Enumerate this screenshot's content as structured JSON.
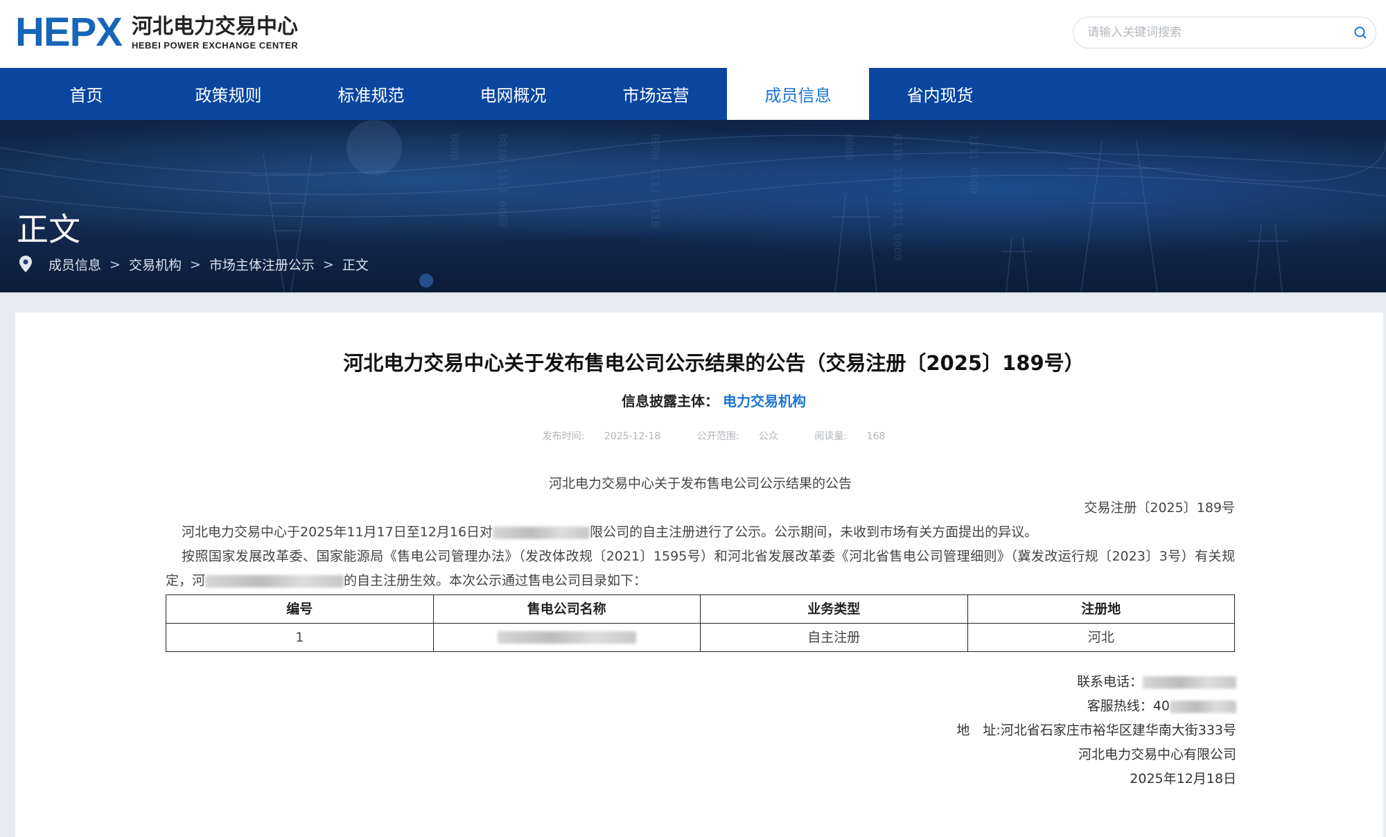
{
  "header": {
    "logo_mark": "HEPX",
    "logo_cn": "河北电力交易中心",
    "logo_en": "HEBEI POWER EXCHANGE CENTER",
    "search_placeholder": "请输入关键词搜索",
    "search_icon": "search-icon"
  },
  "nav": {
    "items": [
      {
        "label": "首页"
      },
      {
        "label": "政策规则"
      },
      {
        "label": "标准规范"
      },
      {
        "label": "电网概况"
      },
      {
        "label": "市场运营"
      },
      {
        "label": "成员信息",
        "active": true
      },
      {
        "label": "省内现货"
      }
    ],
    "active_color": "#1a74d2",
    "bar_color": "#0a46a0"
  },
  "banner": {
    "title": "正文",
    "pin_icon": "location-pin-icon",
    "breadcrumb": [
      "成员信息",
      "交易机构",
      "市场主体注册公示",
      "正文"
    ],
    "separator": ">"
  },
  "article": {
    "title": "河北电力交易中心关于发布售电公司公示结果的公告（交易注册〔2025〕189号）",
    "subject_label": "信息披露主体：",
    "subject_value": "电力交易机构",
    "meta": {
      "publish_label": "发布时间:",
      "publish_date": "2025-12-18",
      "scope_label": "公开范围:",
      "scope_value": "公众",
      "reads_label": "阅读量:",
      "reads_value": "168"
    },
    "heading": "河北电力交易中心关于发布售电公司公示结果的公告",
    "doc_number": "交易注册〔2025〕189号",
    "para1_a": "河北电力交易中心于2025年11月17日至12月16日对",
    "para1_b": "限公司的自主注册进行了公示。公示期间，未收到市场有关方面提出的异议。",
    "para2_a": "按照国家发展改革委、国家能源局《售电公司管理办法》（发改体改规〔2021〕1595号）和河北省发展改革委《河北省售电公司管理细则》（冀发改运行规〔2023〕3号）有关规定，",
    "para2_b": "河",
    "para2_c": "的自主注册生效。本次公示通过售电公司目录如下：",
    "table": {
      "headers": [
        "编号",
        "售电公司名称",
        "业务类型",
        "注册地"
      ],
      "rows": [
        {
          "no": "1",
          "type": "自主注册",
          "place": "河北"
        }
      ]
    },
    "contact_label": "联系电话：",
    "hotline_label": "客服热线：",
    "hotline_prefix": "40",
    "address": "地　址:河北省石家庄市裕华区建华南大街333号",
    "org": "河北电力交易中心有限公司",
    "date": "2025年12月18日"
  }
}
